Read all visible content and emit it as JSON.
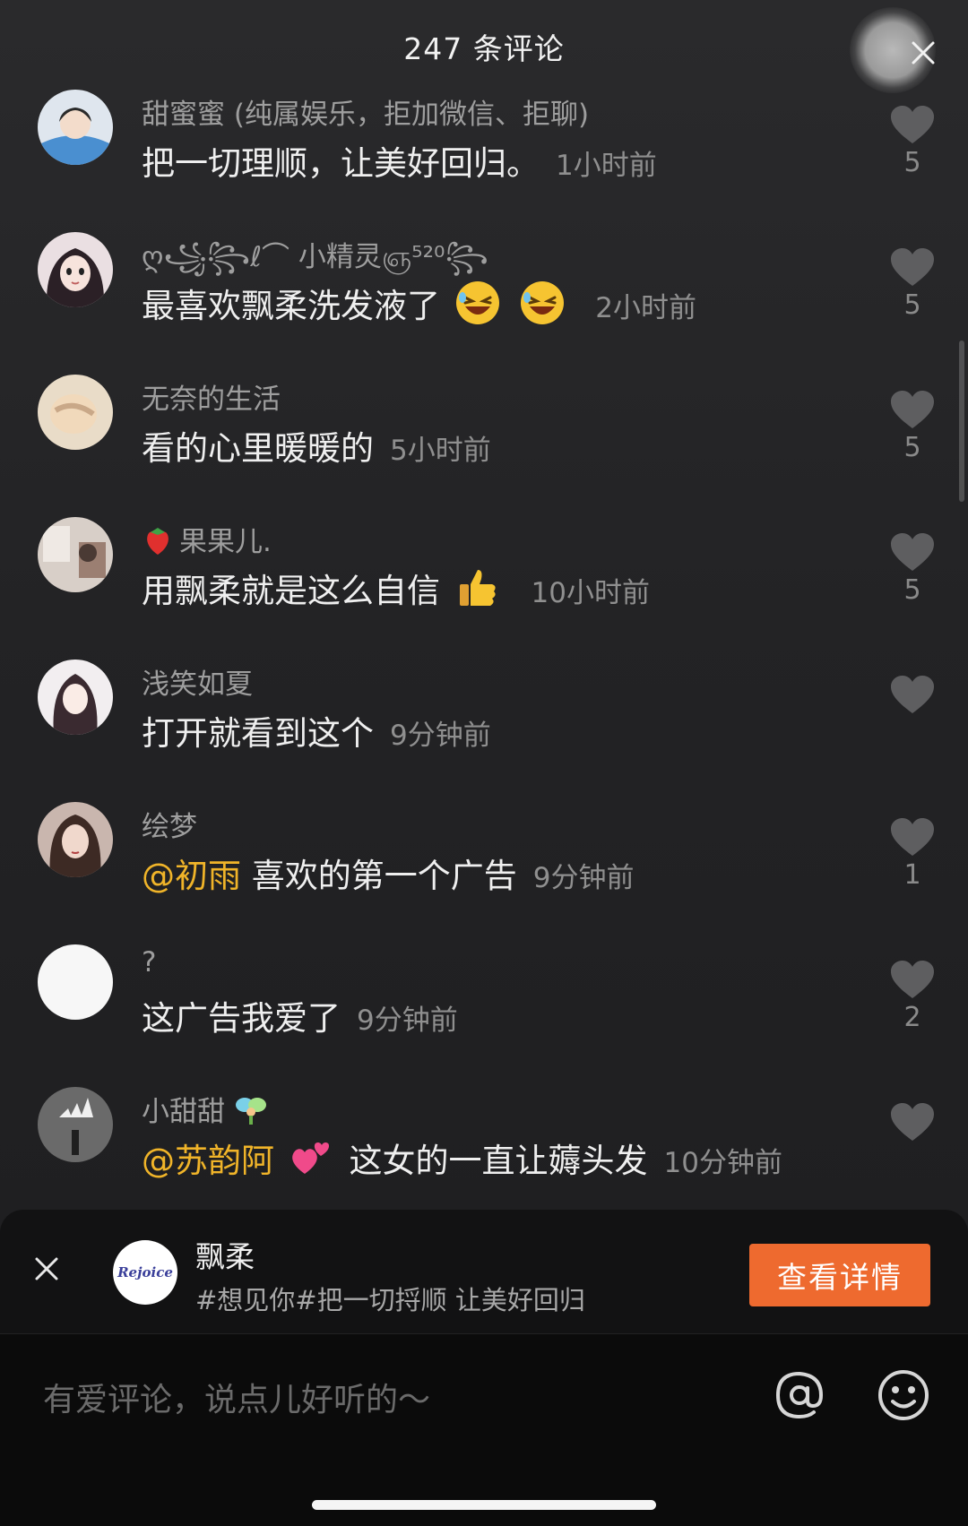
{
  "header": {
    "title": "247 条评论"
  },
  "comments": [
    {
      "user": "甜蜜蜜 (纯属娱乐，拒加微信、拒聊)",
      "text": "把一切理顺，让美好回归。",
      "time": "1小时前",
      "likes": "5"
    },
    {
      "user": "ღ꧁꧂ℓ⌒ 小精灵ஞ⁵²⁰꧂",
      "text": "最喜欢飘柔洗发液了",
      "time": "2小时前",
      "likes": "5"
    },
    {
      "user": "无奈的生活",
      "text": "看的心里暖暖的",
      "time": "5小时前",
      "likes": "5"
    },
    {
      "user": "果果儿.",
      "text": "用飘柔就是这么自信",
      "time": "10小时前",
      "likes": "5"
    },
    {
      "user": "浅笑如夏",
      "text": "打开就看到这个",
      "time": "9分钟前",
      "likes": ""
    },
    {
      "user": "绘梦",
      "mention": "@初雨",
      "text": "喜欢的第一个广告",
      "time": "9分钟前",
      "likes": "1"
    },
    {
      "user": "?",
      "text": "这广告我爱了",
      "time": "9分钟前",
      "likes": "2"
    },
    {
      "user": "小甜甜",
      "mention": "@苏韵阿",
      "text": "这女的一直让薅头发",
      "time": "10分钟前",
      "likes": ""
    }
  ],
  "ad": {
    "logo_text": "Rejoice",
    "name": "飘柔",
    "desc": "#想见你#把一切捋顺 让美好回归",
    "button": "查看详情"
  },
  "input": {
    "placeholder": "有爱评论，说点儿好听的～"
  },
  "colors": {
    "accent": "#ee6a2f",
    "mention": "#f0b429"
  }
}
